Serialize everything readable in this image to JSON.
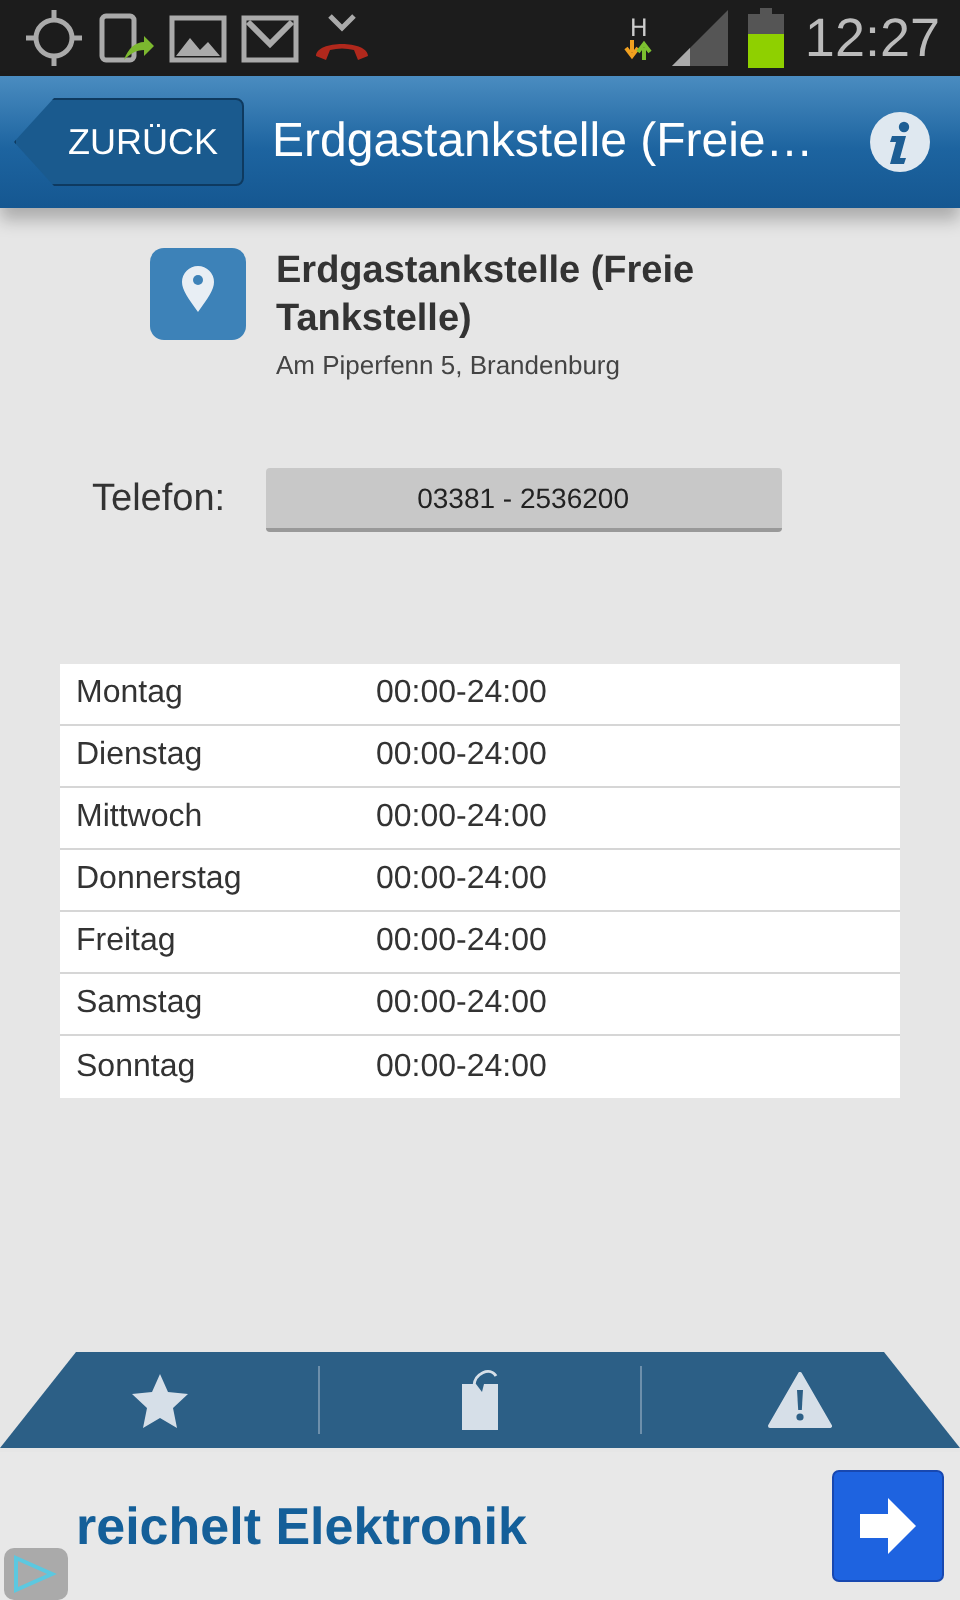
{
  "status_bar": {
    "network": "H",
    "time": "12:27"
  },
  "header": {
    "back_label": "ZURÜCK",
    "title": "Erdgastankstelle (Freie…"
  },
  "place": {
    "name": "Erdgastankstelle (Freie Tankstelle)",
    "address": "Am Piperfenn 5, Brandenburg"
  },
  "phone": {
    "label": "Telefon:",
    "number": "03381 - 2536200"
  },
  "hours": [
    {
      "day": "Montag",
      "time": "00:00-24:00"
    },
    {
      "day": "Dienstag",
      "time": "00:00-24:00"
    },
    {
      "day": "Mittwoch",
      "time": "00:00-24:00"
    },
    {
      "day": "Donnerstag",
      "time": "00:00-24:00"
    },
    {
      "day": "Freitag",
      "time": "00:00-24:00"
    },
    {
      "day": "Samstag",
      "time": "00:00-24:00"
    },
    {
      "day": "Sonntag",
      "time": "00:00-24:00"
    }
  ],
  "ad": {
    "text": "reichelt Elektronik"
  }
}
